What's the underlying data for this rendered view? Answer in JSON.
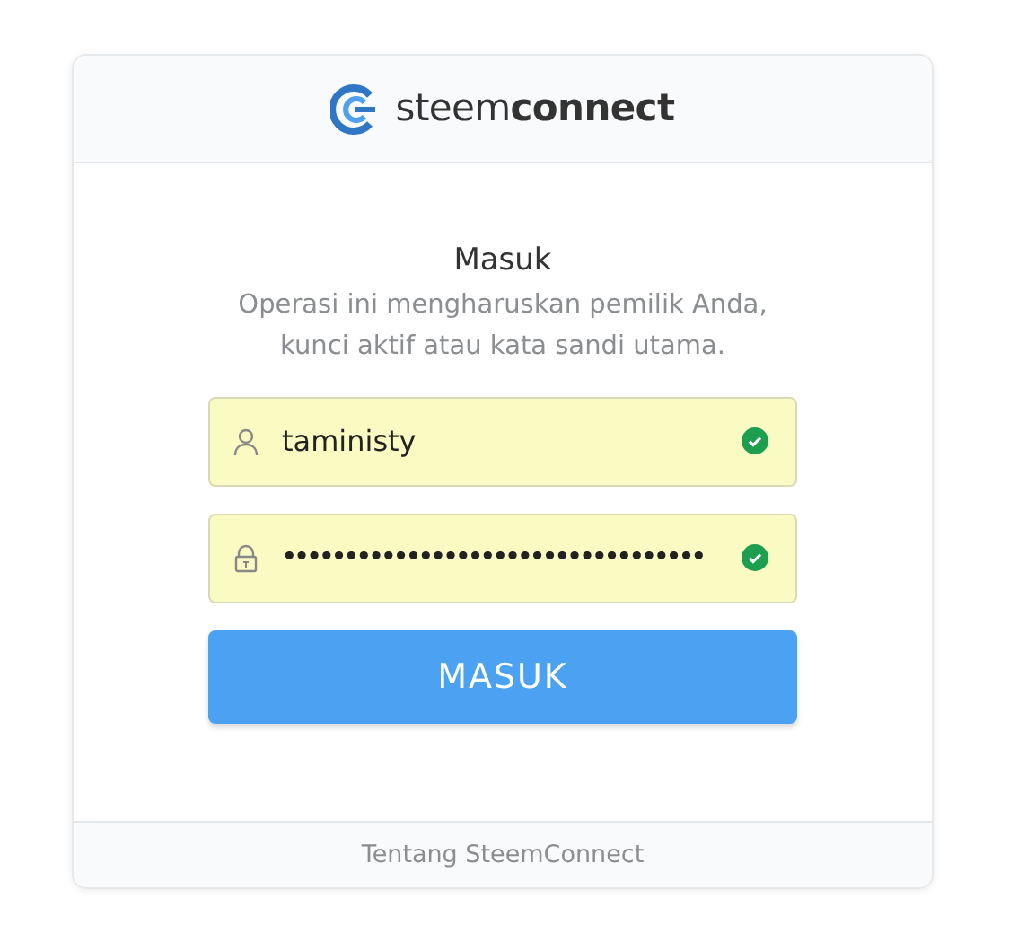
{
  "brand": {
    "light": "steem",
    "bold": "connect"
  },
  "title": "Masuk",
  "description": "Operasi ini mengharuskan pemilik Anda, kunci aktif atau kata sandi utama.",
  "fields": [
    {
      "kind": "user",
      "value": "taministy",
      "valid": true
    },
    {
      "kind": "password",
      "value": "••••••••••••••••••••••••••••••••••",
      "valid": true
    }
  ],
  "submit": "MASUK",
  "footer_link": "Tentang SteemConnect"
}
